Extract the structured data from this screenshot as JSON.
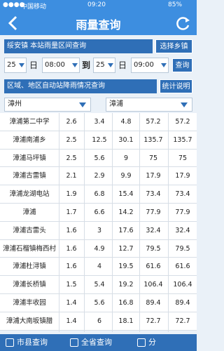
{
  "status": {
    "carrier": "中国移动",
    "time": "09:20",
    "battery": "85%"
  },
  "nav": {
    "title": "雨量查询",
    "back_icon": "back-arrow-icon",
    "refresh_icon": "refresh-icon"
  },
  "station_bar": {
    "label": "绥安镇  本站雨量区间查询",
    "button": "选择乡镇"
  },
  "time_range": {
    "start_day": "25",
    "start_label": "日",
    "start_time": "08:00",
    "to_label": "到",
    "end_day": "25",
    "end_label": "日",
    "end_time": "09:00",
    "query_button": "查询"
  },
  "region_bar": {
    "label": "区域、地区自动站降雨情况查询",
    "button": "统计说明"
  },
  "selectors": {
    "city": "漳州",
    "county": "漳浦"
  },
  "table": {
    "rows": [
      [
        "漳浦第二中学",
        "2.6",
        "3.4",
        "4.8",
        "57.2",
        "57.2"
      ],
      [
        "漳浦南浦乡",
        "2.5",
        "12.5",
        "30.1",
        "135.7",
        "135.7"
      ],
      [
        "漳浦马坪镇",
        "2.5",
        "5.6",
        "9",
        "75",
        "75"
      ],
      [
        "漳浦古雷镇",
        "2.1",
        "2.9",
        "9.9",
        "17.9",
        "17.9"
      ],
      [
        "漳浦龙湖电站",
        "1.9",
        "6.8",
        "15.4",
        "73.4",
        "73.4"
      ],
      [
        "漳浦",
        "1.7",
        "6.6",
        "14.2",
        "77.9",
        "77.9"
      ],
      [
        "漳浦古雷头",
        "1.6",
        "3",
        "17.6",
        "32.4",
        "32.4"
      ],
      [
        "漳浦石榴镇梅西村",
        "1.6",
        "4.9",
        "12.7",
        "79.5",
        "79.5"
      ],
      [
        "漳浦杜浔镇",
        "1.6",
        "4",
        "19.5",
        "61.6",
        "61.6"
      ],
      [
        "漳浦长桥镇",
        "1.5",
        "5.4",
        "19.2",
        "106.4",
        "106.4"
      ],
      [
        "漳浦丰收园",
        "1.4",
        "5.6",
        "16.8",
        "89.4",
        "89.4"
      ],
      [
        "漳浦大南坂镇腊",
        "1.4",
        "6",
        "18.1",
        "72.7",
        "72.7"
      ]
    ]
  },
  "tabs": [
    {
      "label": "市县查询",
      "icon": "city-icon"
    },
    {
      "label": "全省查询",
      "icon": "province-icon"
    },
    {
      "label": "分",
      "icon": "split-icon"
    }
  ]
}
